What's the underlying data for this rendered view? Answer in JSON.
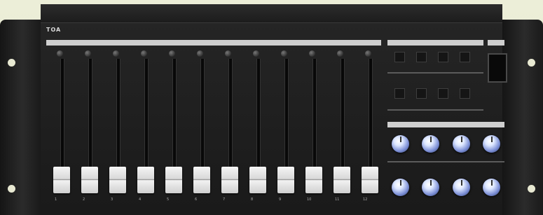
{
  "device": {
    "brand": "TOA",
    "faceplate_text": [
      "",
      ""
    ]
  },
  "channels": [
    {
      "label": "1"
    },
    {
      "label": "2"
    },
    {
      "label": "3"
    },
    {
      "label": "4"
    },
    {
      "label": "5"
    },
    {
      "label": "6"
    },
    {
      "label": "7"
    },
    {
      "label": "8"
    },
    {
      "label": "9"
    },
    {
      "label": "10"
    },
    {
      "label": "11"
    },
    {
      "label": "12"
    }
  ],
  "sections": {
    "left_strip_label": "",
    "right_strip_label": "",
    "output_strip_label": ""
  },
  "colors": {
    "background": "#e8e9d3",
    "panel": "#202020",
    "fader_cap": "#f0f0f0",
    "knob_blue": "#7c8fd6"
  }
}
